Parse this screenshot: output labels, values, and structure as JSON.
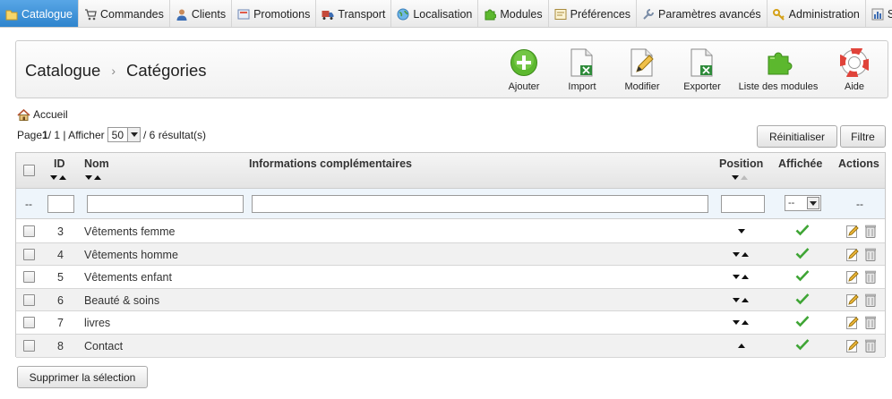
{
  "nav": {
    "tabs": [
      {
        "label": "Catalogue",
        "icon": "folder-icon",
        "active": true
      },
      {
        "label": "Commandes",
        "icon": "cart-icon",
        "active": false
      },
      {
        "label": "Clients",
        "icon": "user-icon",
        "active": false
      },
      {
        "label": "Promotions",
        "icon": "voucher-icon",
        "active": false
      },
      {
        "label": "Transport",
        "icon": "truck-icon",
        "active": false
      },
      {
        "label": "Localisation",
        "icon": "globe-icon",
        "active": false
      },
      {
        "label": "Modules",
        "icon": "puzzle-icon",
        "active": false
      },
      {
        "label": "Préférences",
        "icon": "preferences-icon",
        "active": false
      },
      {
        "label": "Paramètres avancés",
        "icon": "wrench-icon",
        "active": false
      },
      {
        "label": "Administration",
        "icon": "key-icon",
        "active": false
      },
      {
        "label": "St",
        "icon": "stats-icon",
        "active": false
      }
    ]
  },
  "toolbar": {
    "breadcrumb": {
      "part1": "Catalogue",
      "separator": "›",
      "part2": "Catégories"
    },
    "buttons": {
      "add": "Ajouter",
      "import": "Import",
      "modify": "Modifier",
      "export": "Exporter",
      "modules": "Liste des modules",
      "help": "Aide"
    }
  },
  "home": {
    "label": "Accueil"
  },
  "pager": {
    "page_prefix": "Page ",
    "page_current": "1",
    "page_total": " / 1 | Afficher ",
    "per_page": "50",
    "results": " / 6 résultat(s)"
  },
  "actions": {
    "reset": "Réinitialiser",
    "filter": "Filtre",
    "delete_selection": "Supprimer la sélection"
  },
  "table": {
    "headers": {
      "id": "ID",
      "name": "Nom",
      "info": "Informations complémentaires",
      "position": "Position",
      "displayed": "Affichée",
      "actions": "Actions"
    },
    "filter": {
      "dash_left": "--",
      "displayed_select": "--",
      "dash_right": "--"
    },
    "rows": [
      {
        "id": "3",
        "name": "Vêtements femme",
        "down": true,
        "up": false
      },
      {
        "id": "4",
        "name": "Vêtements homme",
        "down": true,
        "up": true
      },
      {
        "id": "5",
        "name": "Vêtements enfant",
        "down": true,
        "up": true
      },
      {
        "id": "6",
        "name": "Beauté & soins",
        "down": true,
        "up": true
      },
      {
        "id": "7",
        "name": "livres",
        "down": true,
        "up": true
      },
      {
        "id": "8",
        "name": "Contact",
        "down": false,
        "up": true
      }
    ]
  },
  "colors": {
    "active_tab": "#3a8fd6",
    "check_green": "#3fa535",
    "add_green": "#5cb82e"
  }
}
